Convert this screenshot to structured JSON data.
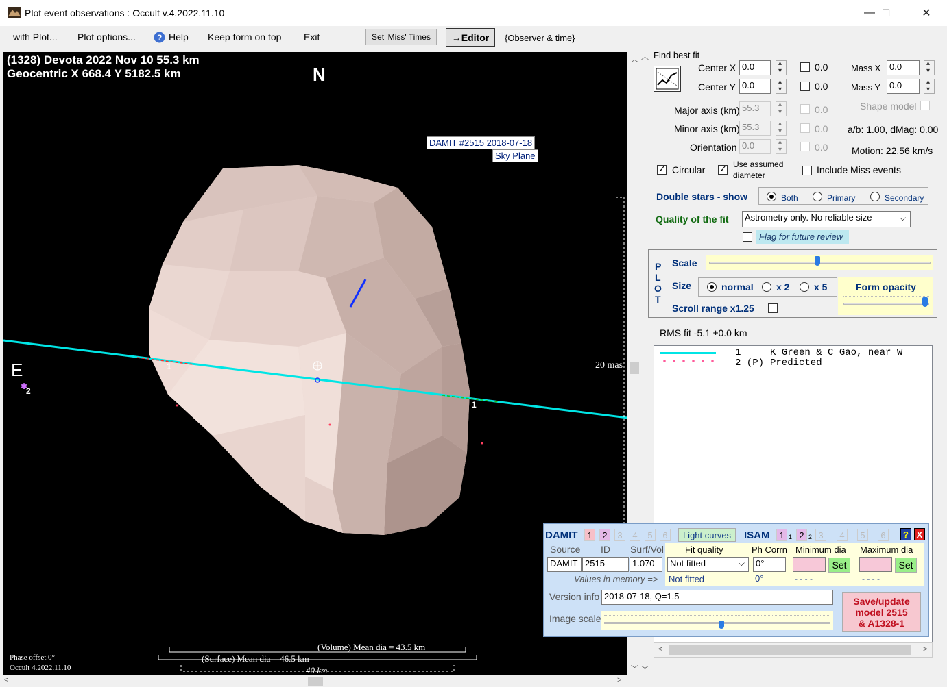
{
  "window": {
    "title": "Plot event observations : Occult v.4.2022.11.10",
    "minimize": "—",
    "maximize": "☐",
    "close": "✕"
  },
  "menu": {
    "with_plot": "with Plot...",
    "plot_options": "Plot options...",
    "help": "Help",
    "keep_on_top": "Keep form on top",
    "exit": "Exit",
    "set_miss": "Set 'Miss' Times",
    "editor": "→Editor",
    "observer_time": "{Observer & time}"
  },
  "plot": {
    "header_line1": "(1328) Devota  2022 Nov 10   55.3 km",
    "header_line2": "Geocentric  X  668.4  Y 5182.5 km",
    "north": "N",
    "east": "E",
    "damit_label1": "DAMIT #2515 2018-07-18",
    "damit_label2": "Sky Plane",
    "scale_mas": "20 mas",
    "chord1_label_left": "1",
    "chord1_label_right": "1",
    "star2_label": "2",
    "volume_dia": "(Volume) Mean dia = 43.5 km",
    "surface_dia": "(Surface) Mean dia = 46.5 km",
    "scale_km": "40 km",
    "phase_offset": "Phase offset 0°",
    "occult_version": "Occult 4.2022.11.10"
  },
  "fit": {
    "find_best_fit": "Find best fit",
    "center_x_label": "Center X",
    "center_x": "0.0",
    "center_x_err": "0.0",
    "center_y_label": "Center Y",
    "center_y": "0.0",
    "center_y_err": "0.0",
    "mass_x_label": "Mass X",
    "mass_x": "0.0",
    "mass_y_label": "Mass Y",
    "mass_y": "0.0",
    "major_label": "Major axis (km)",
    "major": "55.3",
    "major_err": "0.0",
    "minor_label": "Minor axis (km)",
    "minor": "55.3",
    "minor_err": "0.0",
    "orient_label": "Orientation",
    "orient": "0.0",
    "orient_err": "0.0",
    "shape_model": "Shape model",
    "ab_dmag": "a/b: 1.00, dMag: 0.00",
    "motion": "Motion: 22.56 km/s",
    "circular": "Circular",
    "use_assumed_1": "Use assumed",
    "use_assumed_2": "diameter",
    "include_miss": "Include Miss events",
    "double_stars": "Double stars - show",
    "both": "Both",
    "primary": "Primary",
    "secondary": "Secondary",
    "quality_label": "Quality of the fit",
    "quality_value": "Astrometry only. No reliable size",
    "flag_review": "Flag for future review"
  },
  "plotpanel": {
    "p": "P",
    "l": "L",
    "o": "O",
    "t": "T",
    "scale": "Scale",
    "size": "Size",
    "normal": "normal",
    "x2": "x 2",
    "x5": "x 5",
    "form_opacity": "Form opacity",
    "scroll_range": "Scroll range x1.25",
    "scale_level": 0.49,
    "opacity_level": 0.98
  },
  "rms": "RMS fit -5.1 ±0.0 km",
  "legend": [
    {
      "num": "1",
      "text": "K Green & C Gao, near W",
      "color": "#00e5e5"
    },
    {
      "num": "2 (P)",
      "text": "Predicted",
      "color": "#ff5a9a"
    }
  ],
  "damit": {
    "title": "DAMIT",
    "nums": [
      "1",
      "2",
      "3",
      "4",
      "5",
      "6"
    ],
    "light_curves": "Light curves",
    "isam": "ISAM",
    "isam_nums": [
      "1",
      "2",
      "3",
      "4",
      "5",
      "6"
    ],
    "isam_sub1": "1",
    "isam_sub2": "2",
    "help": "?",
    "close": "X",
    "source_h": "Source",
    "id_h": "ID",
    "surfvol_h": "Surf/Vol",
    "fitq_h": "Fit quality",
    "phcorr_h": "Ph Corrn",
    "mindia_h": "Minimum dia",
    "maxdia_h": "Maximum dia",
    "source": "DAMIT",
    "id": "2515",
    "surfvol": "1.070",
    "fitq": "Not fitted",
    "phcorr": "0°",
    "set": "Set",
    "values_memory": "Values in memory =>",
    "mem_fitq": "Not fitted",
    "mem_phcorr": "0°",
    "mem_min": "- - - -",
    "mem_max": "- - - -",
    "version_label": "Version info",
    "version": "2018-07-18, Q=1.5",
    "image_scale": "Image scale",
    "image_scale_level": 0.52,
    "save_line1": "Save/update",
    "save_line2": "model 2515",
    "save_line3": "& A1328-1"
  }
}
